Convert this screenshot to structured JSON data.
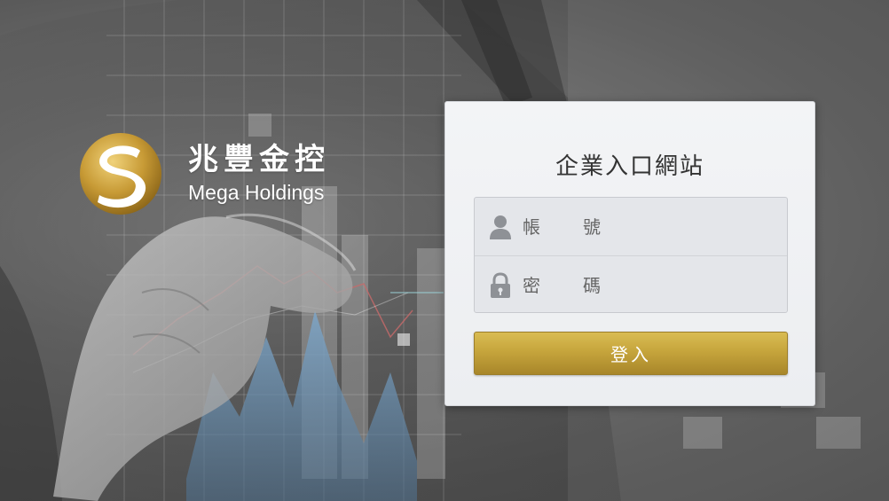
{
  "brand": {
    "name_cn": "兆豐金控",
    "name_en": "Mega Holdings",
    "logo_icon": "mega-s-logo",
    "gold": "#c6a53c"
  },
  "login": {
    "title": "企業入口網站",
    "account": {
      "placeholder": "帳　號",
      "value": "",
      "icon": "user-icon"
    },
    "password": {
      "placeholder": "密　碼",
      "value": "",
      "icon": "lock-icon"
    },
    "submit_label": "登入",
    "button_color": "#c6a53c"
  }
}
